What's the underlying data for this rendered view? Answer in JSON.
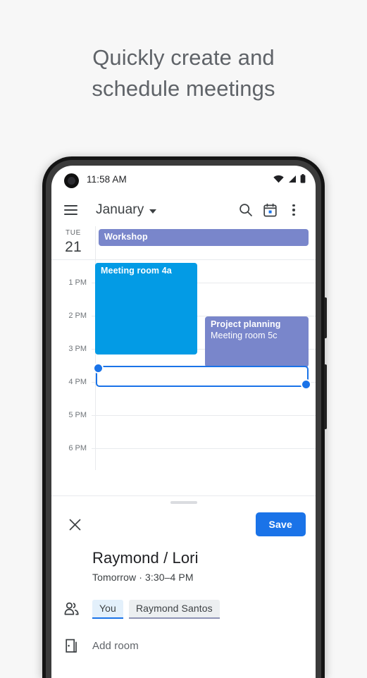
{
  "headline": {
    "line1": "Quickly create and",
    "line2": "schedule meetings"
  },
  "statusbar": {
    "time": "11:58 AM",
    "icons": [
      "wifi-icon",
      "signal-icon",
      "battery-icon"
    ]
  },
  "toolbar": {
    "menu_icon": "hamburger-menu-icon",
    "month": "January",
    "caret_icon": "chevron-down-icon",
    "search_icon": "search-icon",
    "today_icon": "calendar-today-icon",
    "overflow_icon": "more-vertical-icon"
  },
  "calendar": {
    "day_abbr": "TUE",
    "day_num": "21",
    "hours": [
      "1 PM",
      "2 PM",
      "3 PM",
      "4 PM",
      "5 PM",
      "6 PM"
    ],
    "events": [
      {
        "title": "Workshop",
        "subtitle": "",
        "color": "#7986cb",
        "kind": "all-day"
      },
      {
        "title": "Meeting room 4a",
        "subtitle": "",
        "color": "#039be5",
        "kind": "timed"
      },
      {
        "title": "Project planning",
        "subtitle": "Meeting room 5c",
        "color": "#7986cb",
        "kind": "timed"
      }
    ],
    "selection": {
      "accent": "#1a73e8",
      "handle_top_left": "resize-handle-start",
      "handle_bottom_right": "resize-handle-end"
    }
  },
  "sheet": {
    "grabber": "drag-handle",
    "close_label": "✕",
    "save_label": "Save",
    "event_title": "Raymond / Lori",
    "event_when": "Tomorrow  ·  3:30–4 PM",
    "guests_icon": "people-icon",
    "guests": [
      {
        "name": "You",
        "style": "you"
      },
      {
        "name": "Raymond Santos",
        "style": "guest"
      }
    ],
    "room_icon": "door-icon",
    "add_room_label": "Add room"
  },
  "colors": {
    "accent_blue": "#1a73e8",
    "event_blue": "#039be5",
    "event_purple": "#7986cb",
    "text_primary": "#202124",
    "text_secondary": "#5f6368"
  }
}
